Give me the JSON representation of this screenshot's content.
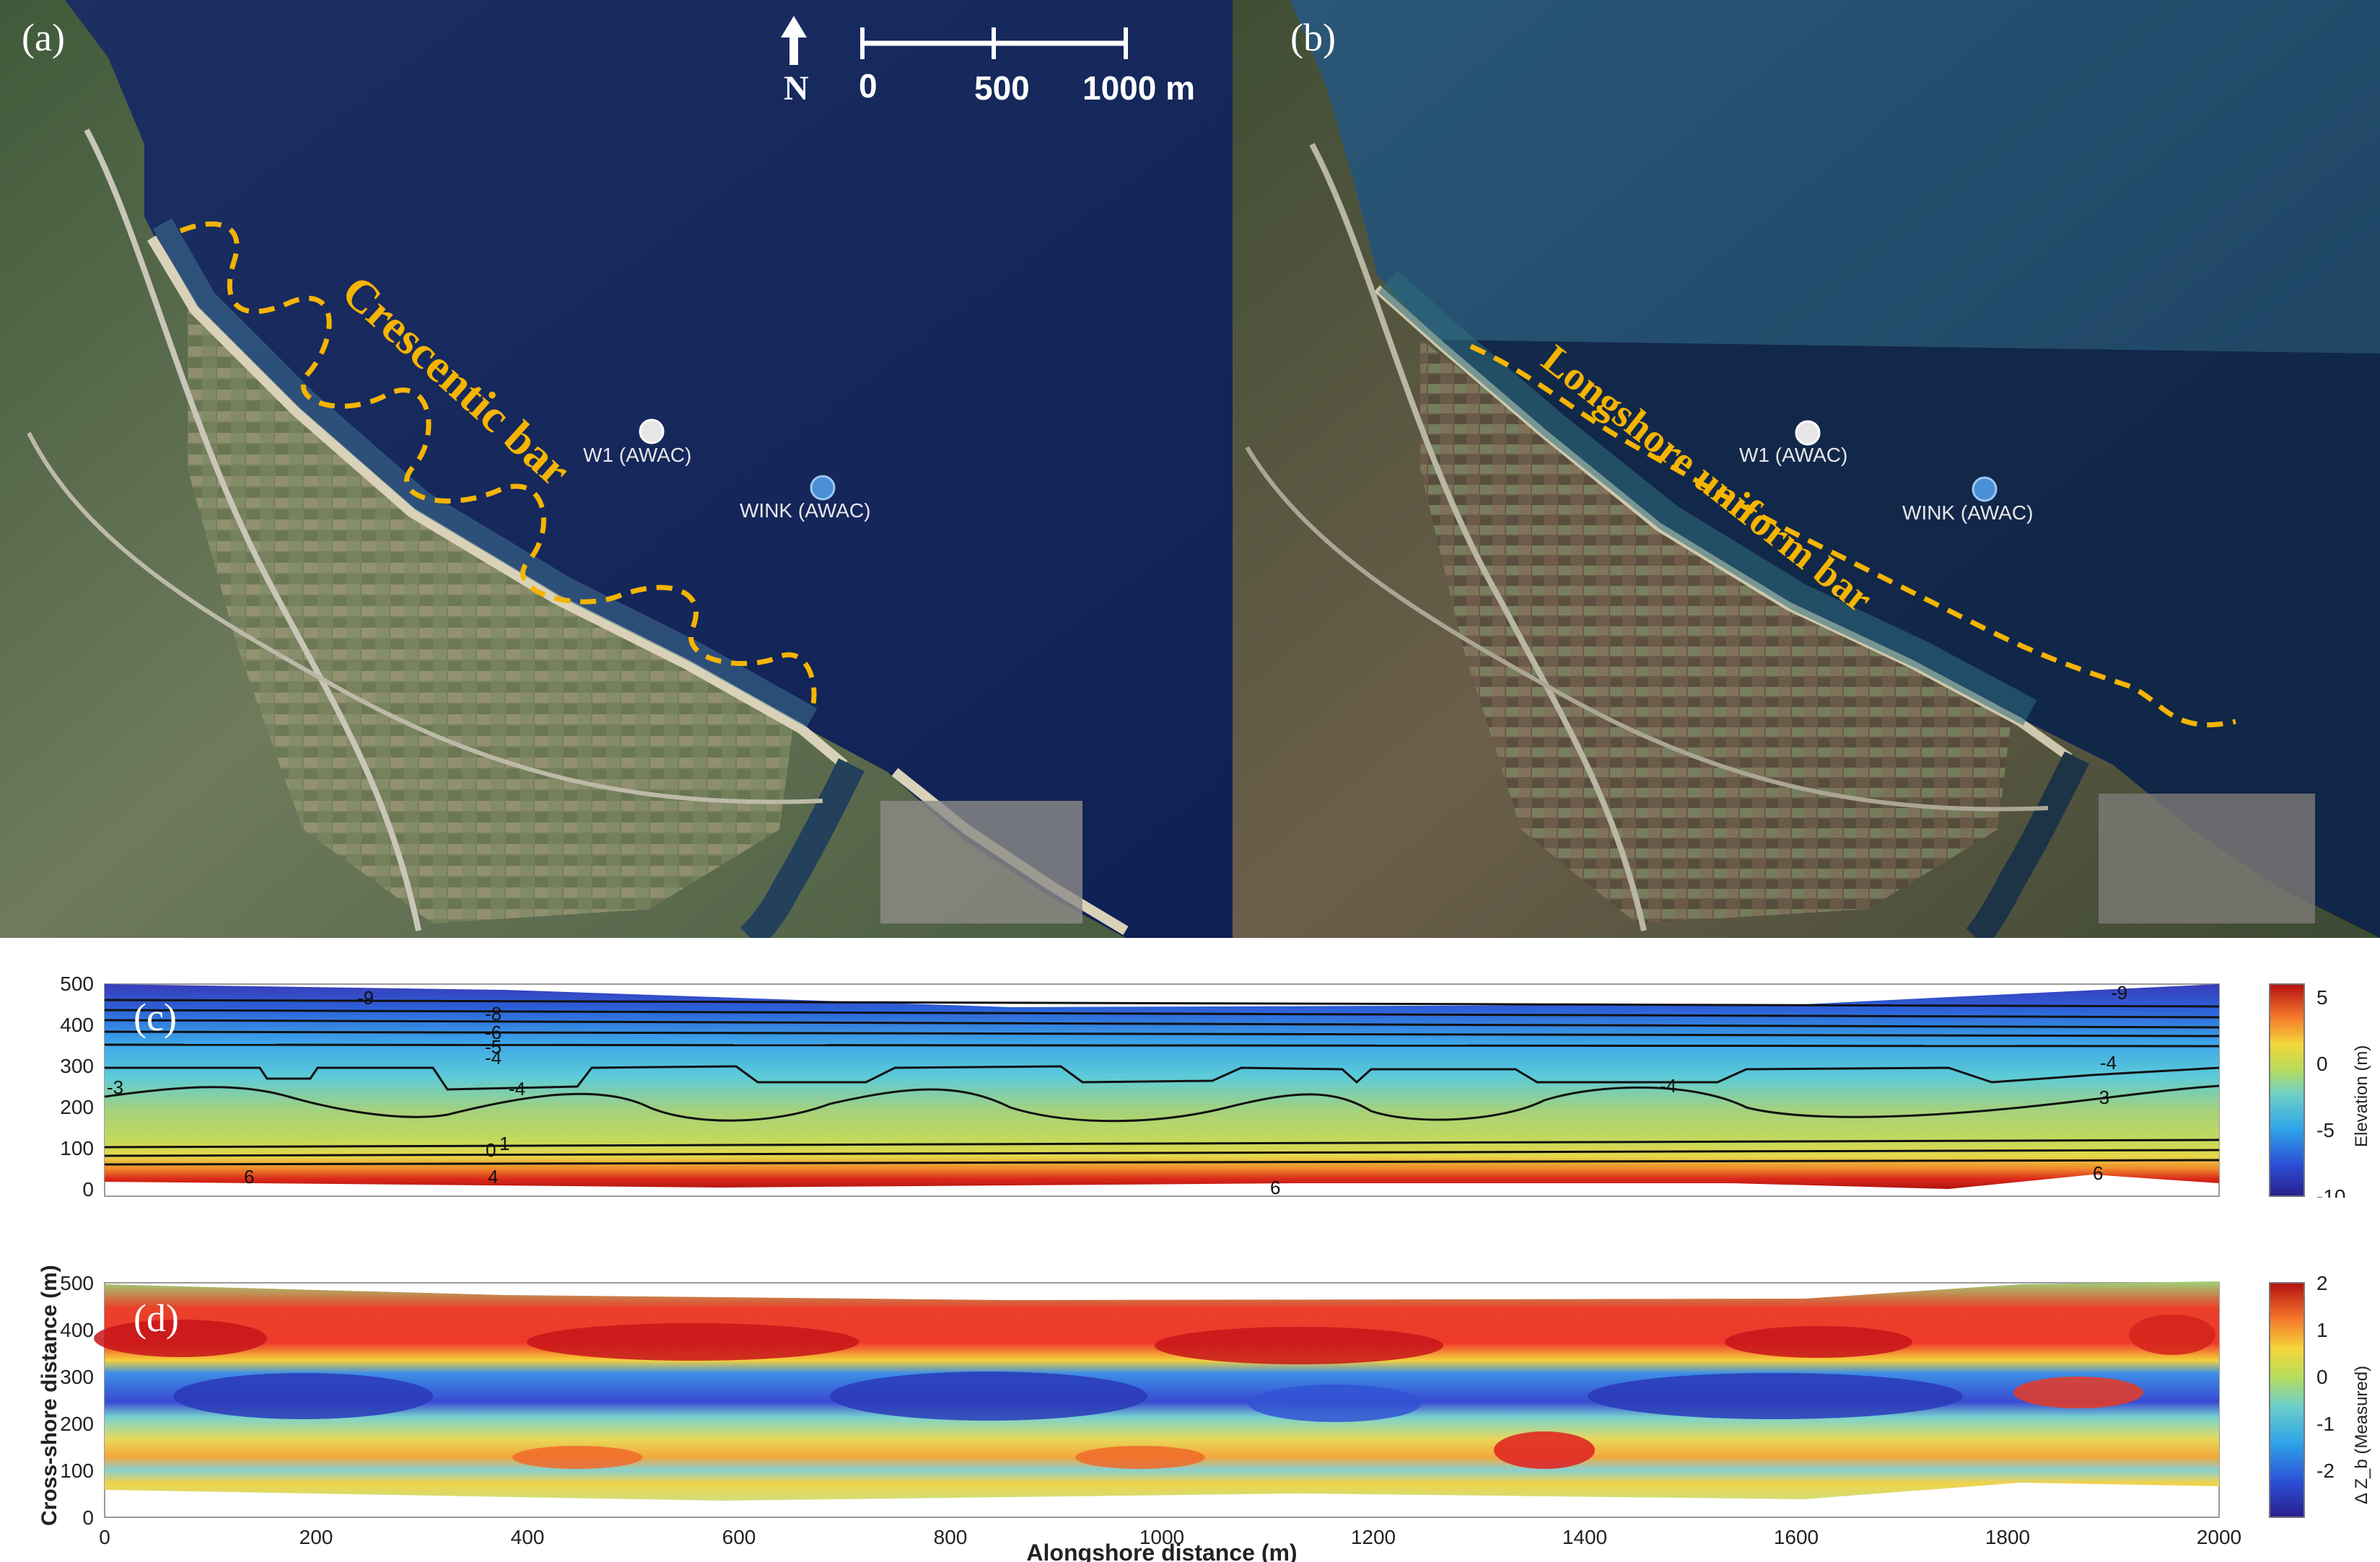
{
  "panels": {
    "a": {
      "label": "(a)",
      "north_label": "N",
      "scale_labels": [
        "0",
        "500",
        "1000 m"
      ],
      "bar_label": "Crescentic bar",
      "stations": [
        {
          "name": "W1 (AWAC)",
          "color": "#d9d9d9"
        },
        {
          "name": "WINK (AWAC)",
          "color": "#4a8fd6"
        }
      ]
    },
    "b": {
      "label": "(b)",
      "bar_label": "Longshore uniform bar",
      "stations": [
        {
          "name": "W1 (AWAC)",
          "color": "#d9d9d9"
        },
        {
          "name": "WINK (AWAC)",
          "color": "#4a8fd6"
        }
      ]
    },
    "c": {
      "label": "(c)",
      "colorbar_title": "Elevation (m)",
      "colorbar_ticks": [
        "5",
        "0",
        "-5",
        "-10"
      ],
      "contour_labels": [
        "-9",
        "-8",
        "-6",
        "-5",
        "-4",
        "-4",
        "-4",
        "-4",
        "-3",
        "-3",
        "0",
        "1",
        "6",
        "6",
        "6",
        "4",
        "-9"
      ]
    },
    "d": {
      "label": "(d)",
      "colorbar_title": "Δ Z_b (Measured)",
      "colorbar_ticks": [
        "2",
        "1",
        "0",
        "-1",
        "-2"
      ]
    }
  },
  "axes": {
    "xlabel": "Alongshore distance (m)",
    "ylabel": "Cross-shore distance (m)",
    "x_ticks": [
      "0",
      "200",
      "400",
      "600",
      "800",
      "1000",
      "1200",
      "1400",
      "1600",
      "1800",
      "2000"
    ],
    "y_ticks": [
      "500",
      "400",
      "300",
      "200",
      "100",
      "0"
    ]
  },
  "chart_data": [
    {
      "type": "heatmap",
      "title": "",
      "xlabel": "",
      "ylabel": "",
      "xlim": [
        0,
        2000
      ],
      "ylim": [
        0,
        500
      ],
      "colorbar": {
        "label": "Elevation (m)",
        "range": [
          -10,
          5
        ]
      },
      "contour_levels_labeled": [
        -9,
        -8,
        -6,
        -5,
        -4,
        -3,
        0,
        1,
        6
      ]
    },
    {
      "type": "heatmap",
      "title": "",
      "xlabel": "Alongshore distance (m)",
      "ylabel": "Cross-shore distance (m)",
      "xlim": [
        0,
        2000
      ],
      "ylim": [
        0,
        500
      ],
      "colorbar": {
        "label": "Δ Z_b (Measured)",
        "range": [
          -2,
          2
        ]
      }
    }
  ]
}
